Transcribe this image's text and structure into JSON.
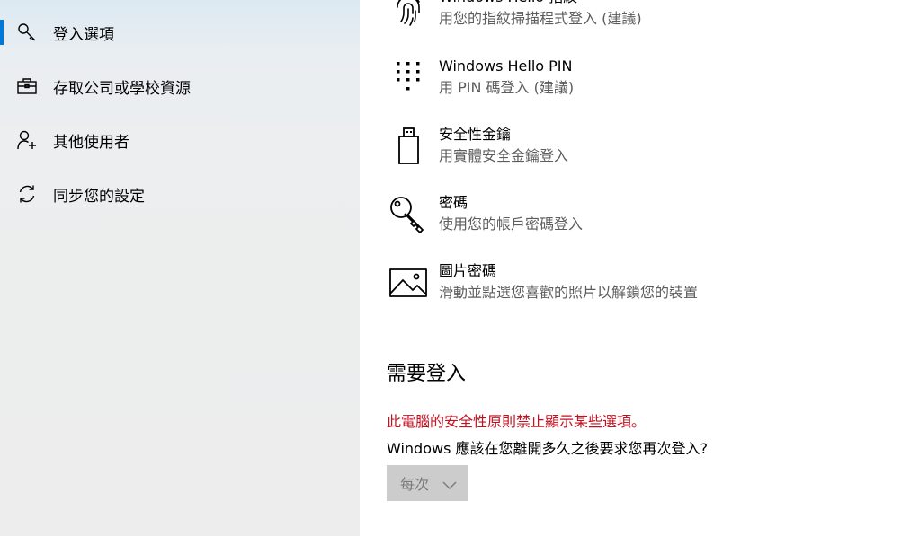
{
  "sidebar": {
    "items": [
      {
        "label": "登入選項",
        "icon": "key-search-icon",
        "selected": true
      },
      {
        "label": "存取公司或學校資源",
        "icon": "briefcase-icon",
        "selected": false
      },
      {
        "label": "其他使用者",
        "icon": "add-person-icon",
        "selected": false
      },
      {
        "label": "同步您的設定",
        "icon": "sync-icon",
        "selected": false
      }
    ]
  },
  "main": {
    "options": [
      {
        "title": "Windows Hello 指紋",
        "subtitle": "用您的指紋掃描程式登入 (建議)",
        "icon": "fingerprint-icon"
      },
      {
        "title": "Windows Hello PIN",
        "subtitle": "用 PIN 碼登入 (建議)",
        "icon": "pin-keypad-icon"
      },
      {
        "title": "安全性金鑰",
        "subtitle": "用實體安全金鑰登入",
        "icon": "usb-key-icon"
      },
      {
        "title": "密碼",
        "subtitle": "使用您的帳戶密碼登入",
        "icon": "key-icon"
      },
      {
        "title": "圖片密碼",
        "subtitle": "滑動並點選您喜歡的照片以解鎖您的裝置",
        "icon": "picture-icon"
      }
    ],
    "require_signin": {
      "title": "需要登入",
      "policy_warning": "此電腦的安全性原則禁止顯示某些選項。",
      "question": "Windows 應該在您離開多久之後要求您再次登入?",
      "dropdown_value": "每次"
    }
  },
  "colors": {
    "accent": "#0078d7",
    "warning": "#c50f1f",
    "secondary_text": "#5d5d5d",
    "dropdown_bg": "#cccccc"
  }
}
